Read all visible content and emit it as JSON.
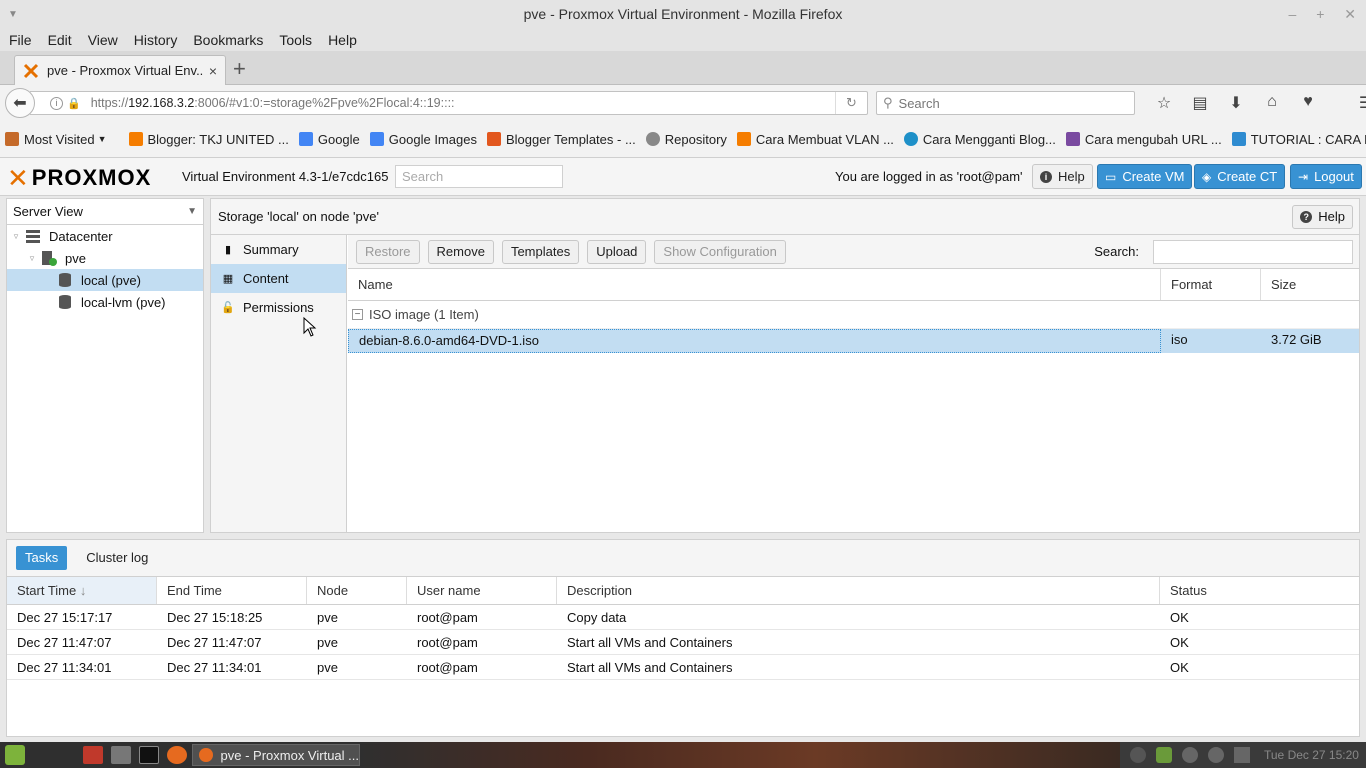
{
  "window": {
    "title": "pve - Proxmox Virtual Environment - Mozilla Firefox",
    "controls": [
      "–",
      "+",
      "✕"
    ]
  },
  "menubar": [
    "File",
    "Edit",
    "View",
    "History",
    "Bookmarks",
    "Tools",
    "Help"
  ],
  "tab": {
    "title": "pve - Proxmox Virtual Env...",
    "close": "×",
    "new": "+"
  },
  "nav": {
    "url_prefix": "https://",
    "url_host": "192.168.3.2",
    "url_rest": ":8006/#v1:0:=storage%2Fpve%2Flocal:4::19::::",
    "search_placeholder": "Search"
  },
  "bookmarks": [
    {
      "label": "Most Visited",
      "color": "#c56a2a"
    },
    {
      "label": "Blogger: TKJ UNITED ...",
      "color": "#f57d00"
    },
    {
      "label": "Google",
      "color": "#4285f4"
    },
    {
      "label": "Google Images",
      "color": "#4285f4"
    },
    {
      "label": "Blogger Templates - ...",
      "color": "#e2571e"
    },
    {
      "label": "Repository",
      "color": "#888888"
    },
    {
      "label": "Cara Membuat VLAN ...",
      "color": "#f57d00"
    },
    {
      "label": "Cara Mengganti Blog...",
      "color": "#1e90c8"
    },
    {
      "label": "Cara mengubah URL ...",
      "color": "#7a4aa0"
    },
    {
      "label": "TUTORIAL : CARA ME...",
      "color": "#2e8bd0"
    }
  ],
  "pve": {
    "logo": "PROXMOX",
    "version": "Virtual Environment 4.3-1/e7cdc165",
    "search_placeholder": "Search",
    "logged_in": "You are logged in as 'root@pam'",
    "help": "Help",
    "create_vm": "Create VM",
    "create_ct": "Create CT",
    "logout": "Logout"
  },
  "tree": {
    "view": "Server View",
    "items": [
      {
        "label": "Datacenter",
        "level": 0
      },
      {
        "label": "pve",
        "level": 1
      },
      {
        "label": "local (pve)",
        "level": 2,
        "selected": true
      },
      {
        "label": "local-lvm (pve)",
        "level": 2
      }
    ]
  },
  "content": {
    "title": "Storage 'local' on node 'pve'",
    "help": "Help",
    "subnav": [
      "Summary",
      "Content",
      "Permissions"
    ],
    "toolbar": {
      "restore": "Restore",
      "remove": "Remove",
      "templates": "Templates",
      "upload": "Upload",
      "show_config": "Show Configuration",
      "search_label": "Search:"
    },
    "columns": [
      "Name",
      "Format",
      "Size"
    ],
    "group": "ISO image (1 Item)",
    "rows": [
      {
        "name": "debian-8.6.0-amd64-DVD-1.iso",
        "format": "iso",
        "size": "3.72 GiB"
      }
    ]
  },
  "tasks": {
    "tabs": [
      "Tasks",
      "Cluster log"
    ],
    "columns": [
      "Start Time",
      "End Time",
      "Node",
      "User name",
      "Description",
      "Status"
    ],
    "sort_indicator": "↓",
    "rows": [
      {
        "start": "Dec 27 15:17:17",
        "end": "Dec 27 15:18:25",
        "node": "pve",
        "user": "root@pam",
        "desc": "Copy data",
        "status": "OK"
      },
      {
        "start": "Dec 27 11:47:07",
        "end": "Dec 27 11:47:07",
        "node": "pve",
        "user": "root@pam",
        "desc": "Start all VMs and Containers",
        "status": "OK"
      },
      {
        "start": "Dec 27 11:34:01",
        "end": "Dec 27 11:34:01",
        "node": "pve",
        "user": "root@pam",
        "desc": "Start all VMs and Containers",
        "status": "OK"
      }
    ]
  },
  "taskbar": {
    "window_title": "pve - Proxmox Virtual ...",
    "clock": "Tue Dec 27 15:20"
  },
  "colors": {
    "accent": "#3892d3",
    "selection": "#c2ddf2",
    "proxmox_orange": "#e57000"
  }
}
